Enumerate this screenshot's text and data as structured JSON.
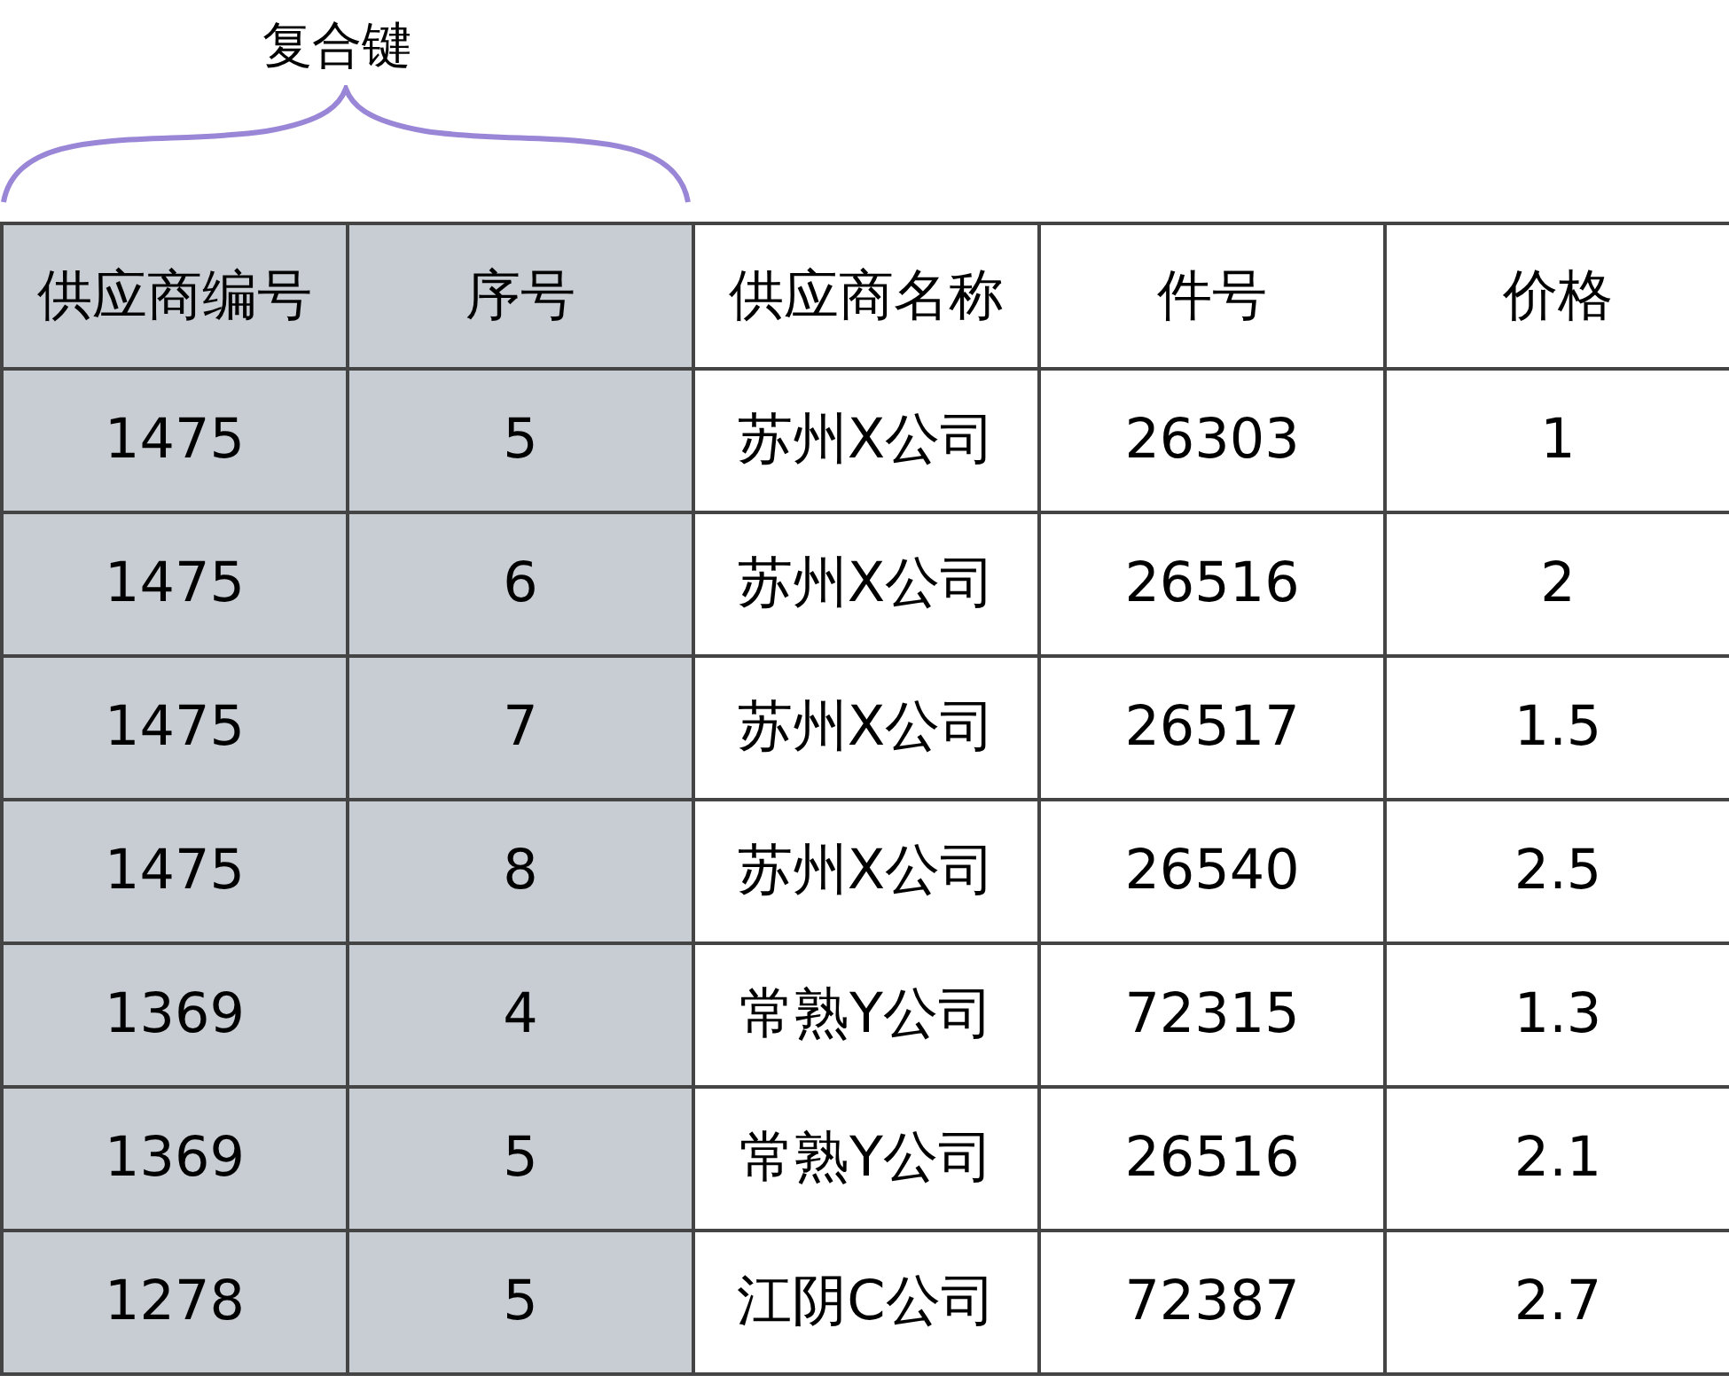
{
  "brace_label": "复合键",
  "table": {
    "columns": [
      {
        "label": "供应商编号",
        "key": true
      },
      {
        "label": "序号",
        "key": true
      },
      {
        "label": "供应商名称",
        "key": false
      },
      {
        "label": "件号",
        "key": false
      },
      {
        "label": "价格",
        "key": false
      }
    ],
    "rows": [
      [
        "1475",
        "5",
        "苏州X公司",
        "26303",
        "1"
      ],
      [
        "1475",
        "6",
        "苏州X公司",
        "26516",
        "2"
      ],
      [
        "1475",
        "7",
        "苏州X公司",
        "26517",
        "1.5"
      ],
      [
        "1475",
        "8",
        "苏州X公司",
        "26540",
        "2.5"
      ],
      [
        "1369",
        "4",
        "常熟Y公司",
        "72315",
        "1.3"
      ],
      [
        "1369",
        "5",
        "常熟Y公司",
        "26516",
        "2.1"
      ],
      [
        "1278",
        "5",
        "江阴C公司",
        "72387",
        "2.7"
      ]
    ]
  }
}
